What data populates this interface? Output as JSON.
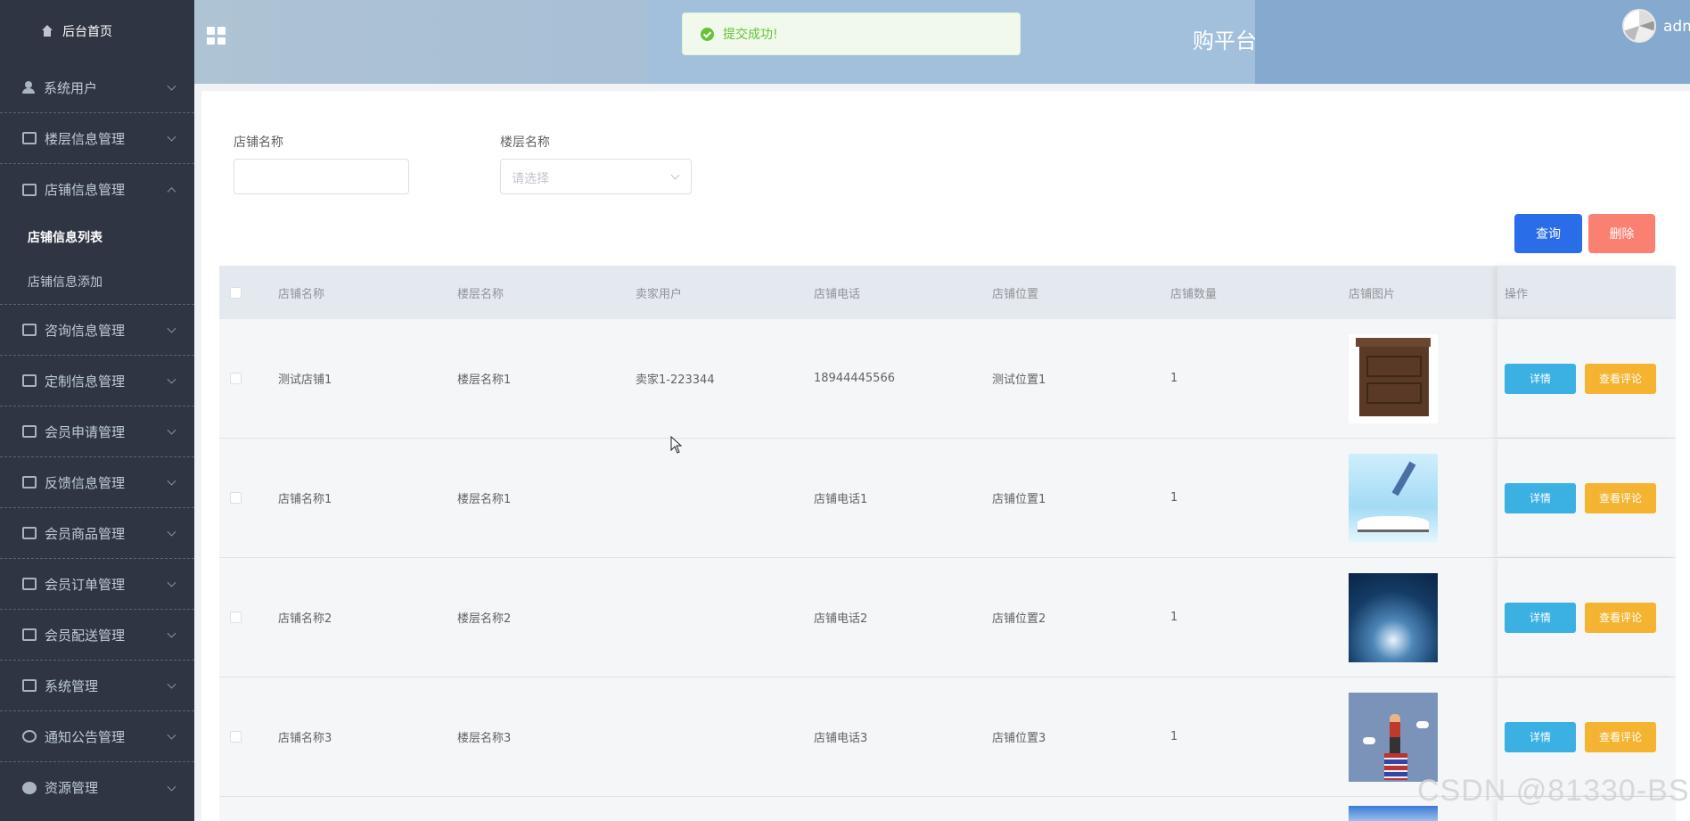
{
  "sidebar": {
    "home": "后台首页",
    "items": [
      {
        "label": "系统用户"
      },
      {
        "label": "楼层信息管理"
      },
      {
        "label": "店铺信息管理",
        "submenu": [
          "店铺信息列表",
          "店铺信息添加"
        ]
      },
      {
        "label": "咨询信息管理"
      },
      {
        "label": "定制信息管理"
      },
      {
        "label": "会员申请管理"
      },
      {
        "label": "反馈信息管理"
      },
      {
        "label": "会员商品管理"
      },
      {
        "label": "会员订单管理"
      },
      {
        "label": "会员配送管理"
      },
      {
        "label": "系统管理"
      },
      {
        "label": "通知公告管理"
      },
      {
        "label": "资源管理"
      }
    ]
  },
  "header": {
    "title_fragment": "购平台",
    "user": "admin"
  },
  "toast": {
    "message": "提交成功!"
  },
  "filters": {
    "shop_name_label": "店铺名称",
    "floor_name_label": "楼层名称",
    "floor_placeholder": "请选择"
  },
  "buttons": {
    "query": "查询",
    "delete": "删除"
  },
  "table": {
    "headers": [
      "店铺名称",
      "楼层名称",
      "卖家用户",
      "店铺电话",
      "店铺位置",
      "店铺数量",
      "店铺图片",
      "操作"
    ],
    "rows": [
      {
        "shop": "测试店铺1",
        "floor": "楼层名称1",
        "seller": "卖家1-223344",
        "phone": "18944445566",
        "location": "测试位置1",
        "count": "1",
        "image": "nightstand"
      },
      {
        "shop": "店铺名称1",
        "floor": "楼层名称1",
        "seller": "",
        "phone": "店铺电话1",
        "location": "店铺位置1",
        "count": "1",
        "image": "open-book"
      },
      {
        "shop": "店铺名称2",
        "floor": "楼层名称2",
        "seller": "",
        "phone": "店铺电话2",
        "location": "店铺位置2",
        "count": "1",
        "image": "lightbulb"
      },
      {
        "shop": "店铺名称3",
        "floor": "楼层名称3",
        "seller": "",
        "phone": "店铺电话3",
        "location": "店铺位置3",
        "count": "1",
        "image": "telescope-man"
      }
    ],
    "detail_label": "详情",
    "review_label": "查看评论"
  },
  "watermark": "CSDN @81330-BS"
}
